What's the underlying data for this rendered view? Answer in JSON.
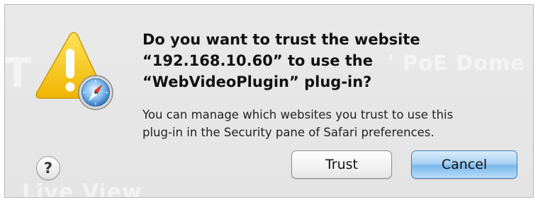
{
  "dialog": {
    "title_lines": [
      "Do you want to trust the website",
      "“192.168.10.60” to use the",
      "“WebVideoPlugin” plug-in?"
    ],
    "description_lines": [
      "You can manage which websites you trust to use this",
      "plug-in in the Security pane of Safari preferences."
    ],
    "help_label": "?",
    "trust_label": "Trust",
    "cancel_label": "Cancel",
    "icons": {
      "warning": "warning-triangle-icon",
      "app_badge": "safari-compass-icon"
    },
    "colors": {
      "warning_yellow": "#f5c80a",
      "default_button_blue": "#7ab8ec"
    }
  },
  "background": {
    "ghost_text_1": "' PoE Dome Da",
    "ghost_text_2": "Live View",
    "ghost_text_3": "T"
  }
}
